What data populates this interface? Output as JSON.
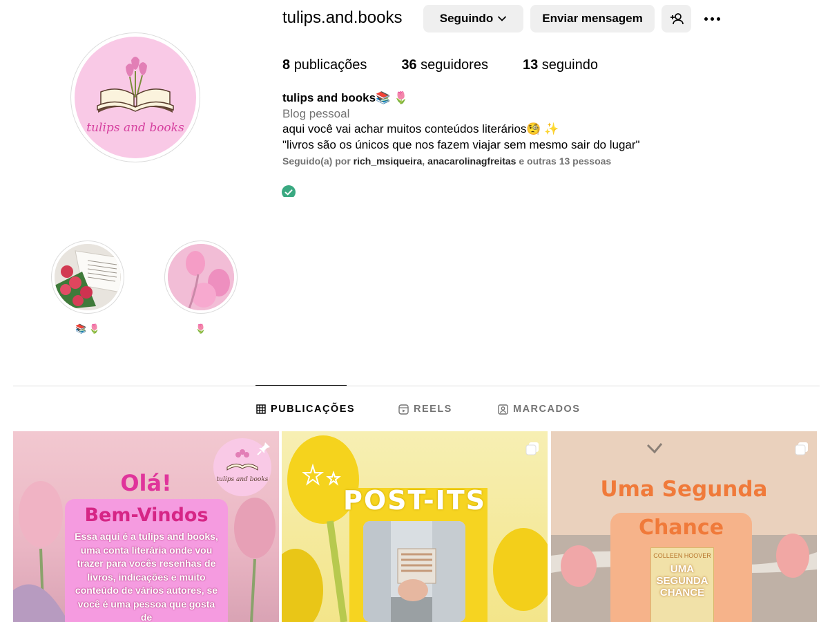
{
  "profile": {
    "username": "tulips.and.books",
    "avatar_text": "tulips and books",
    "buttons": {
      "following": "Seguindo",
      "message": "Enviar mensagem"
    },
    "stats": {
      "posts_count": "8",
      "posts_label": "publicações",
      "followers_count": "36",
      "followers_label": "seguidores",
      "following_count": "13",
      "following_label": "seguindo"
    },
    "bio": {
      "name": "tulips and books📚 🌷",
      "category": "Blog pessoal",
      "line1": "aqui você vai achar muitos conteúdos literários🧐 ✨",
      "line2": "\"livros são os únicos que nos fazem viajar sem mesmo sair do lugar\"",
      "followed_prefix": "Seguido(a) por ",
      "followed_user1": "rich_msiqueira",
      "followed_sep": ", ",
      "followed_user2": "anacarolinagfreitas",
      "followed_suffix": " e outras 13 pessoas"
    }
  },
  "highlights": [
    {
      "label": "📚 🌷"
    },
    {
      "label": "🌷"
    }
  ],
  "tabs": [
    {
      "label": "PUBLICAÇÕES",
      "active": true
    },
    {
      "label": "REELS",
      "active": false
    },
    {
      "label": "MARCADOS",
      "active": false
    }
  ],
  "posts": [
    {
      "badge": "tulips and books",
      "title": "Olá!",
      "subtitle": "Bem-Vindos",
      "body": "Essa aqui é a tulips and books, uma conta literária onde vou trazer para vocês resenhas de livros, indicações e muito conteúdo de vários autores, se você é uma pessoa que gosta de"
    },
    {
      "title": "POST-ITS"
    },
    {
      "title": "Uma Segunda",
      "subtitle": "Chance",
      "book_author": "COLLEEN HOOVER",
      "book_title": "UMA SEGUNDA CHANCE"
    }
  ],
  "colors": {
    "accent_pink": "#d6409f",
    "verified_green": "#3aa981",
    "button_bg": "#efefef",
    "muted_text": "#737373"
  }
}
